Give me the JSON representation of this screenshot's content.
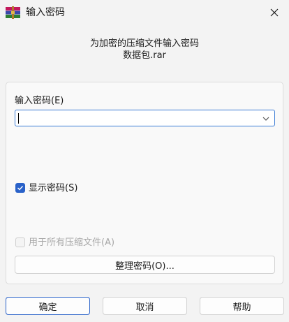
{
  "window": {
    "title": "输入密码",
    "icon": "winrar-books-icon"
  },
  "prompt": {
    "line1": "为加密的压缩文件输入密码",
    "line2": "数据包.rar"
  },
  "password": {
    "label": "输入密码(E)",
    "value": ""
  },
  "show_password": {
    "label": "显示密码(S)",
    "checked": true
  },
  "use_for_all": {
    "label": "用于所有压缩文件(A)",
    "checked": false,
    "enabled": false
  },
  "buttons": {
    "organize": "整理密码(O)...",
    "ok": "确定",
    "cancel": "取消",
    "help": "帮助"
  },
  "colors": {
    "accent": "#2a62c9",
    "background": "#f3f3f3",
    "disabled_text": "#a8a8a8"
  }
}
